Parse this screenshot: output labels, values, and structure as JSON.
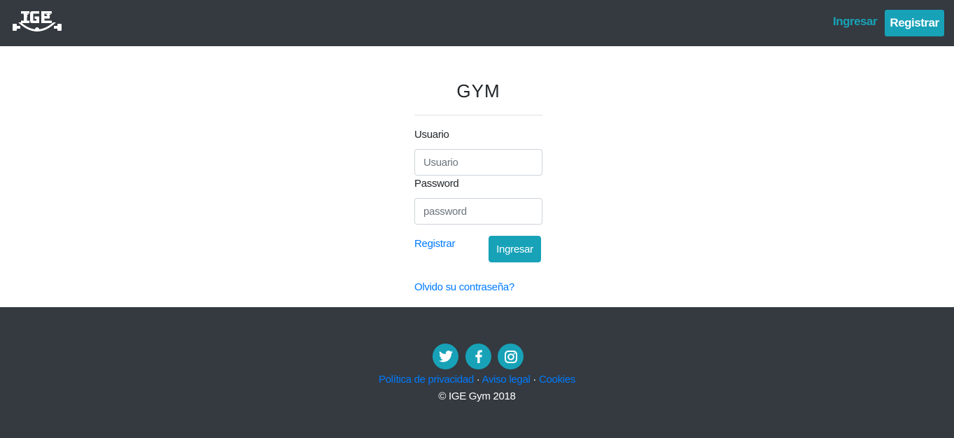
{
  "navbar": {
    "logo_text": "IGE",
    "ingresar_label": "Ingresar",
    "registrar_label": "Registrar"
  },
  "login": {
    "title": "GYM",
    "usuario_label": "Usuario",
    "usuario_placeholder": "Usuario",
    "usuario_value": "",
    "password_label": "Password",
    "password_placeholder": "password",
    "password_value": "",
    "registrar_link": "Registrar",
    "ingresar_button": "Ingresar",
    "forgot_link": "Olvido su contraseña?"
  },
  "footer": {
    "social": [
      {
        "name": "twitter-icon"
      },
      {
        "name": "facebook-icon"
      },
      {
        "name": "instagram-icon"
      }
    ],
    "links": {
      "privacy": "Política de privacidad",
      "separator": "·",
      "legal": "Aviso legal",
      "cookies": "Cookies"
    },
    "copyright": "© IGE Gym 2018"
  },
  "colors": {
    "dark": "#343a40",
    "accent": "#17a2b8",
    "link": "#007bff"
  }
}
